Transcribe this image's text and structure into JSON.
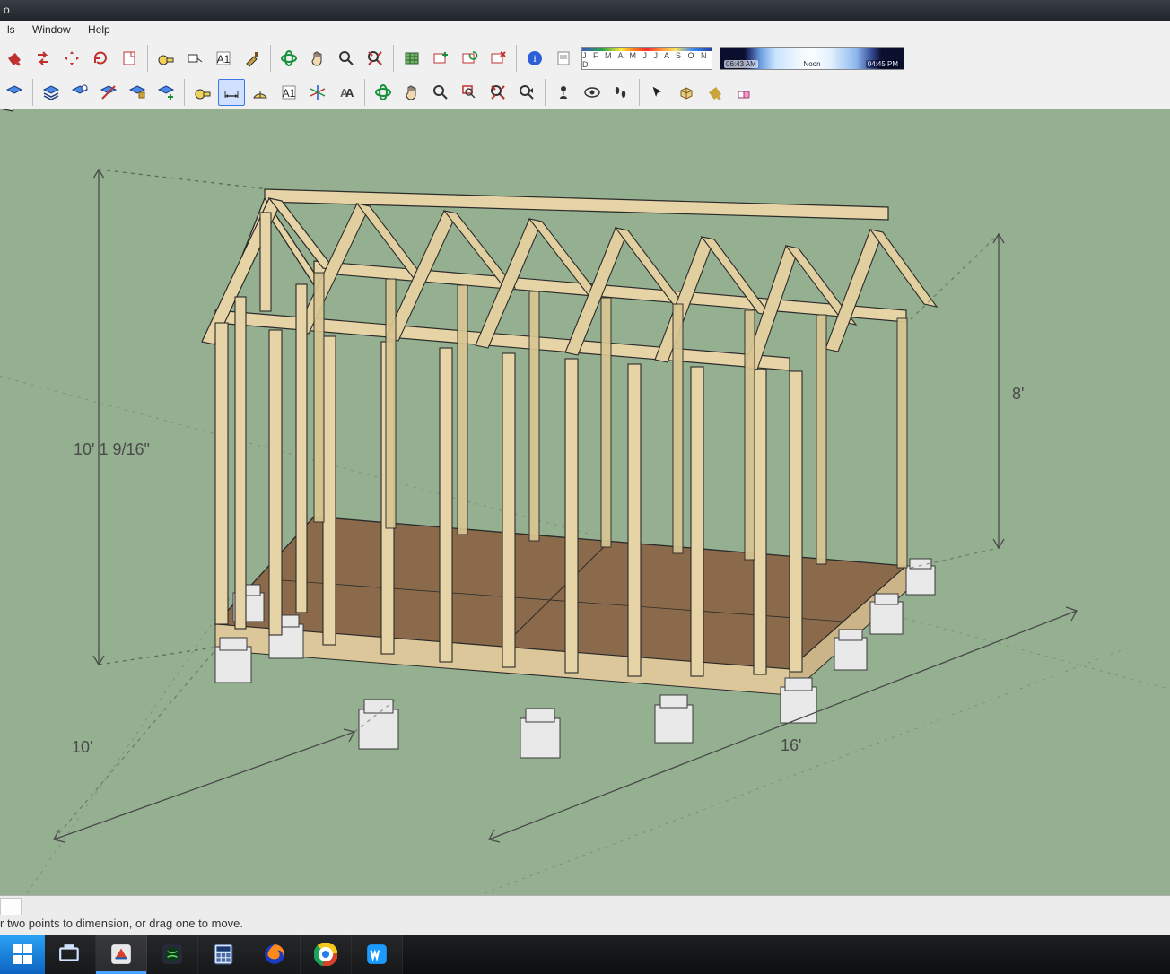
{
  "titlebar": {
    "fragment": "o"
  },
  "menu": {
    "items": [
      "ls",
      "Window",
      "Help"
    ]
  },
  "toolbar": {
    "row1": [
      {
        "n": "paint-bucket-icon",
        "i": "bucket",
        "c": "#c03030"
      },
      {
        "n": "hide-icon",
        "i": "arrowswap",
        "c": "#c03030"
      },
      {
        "n": "move-icon",
        "i": "movecross",
        "c": "#c03030"
      },
      {
        "n": "refresh-icon",
        "i": "refresh",
        "c": "#c03030"
      },
      {
        "n": "page-icon",
        "i": "pagecorner",
        "c": "#c03030"
      },
      {
        "n": "SEP"
      },
      {
        "n": "tape-icon",
        "i": "tape",
        "c": "#333"
      },
      {
        "n": "label-icon",
        "i": "labeltag",
        "c": "#333"
      },
      {
        "n": "text-icon",
        "i": "textA",
        "c": "#333"
      },
      {
        "n": "axis-brush-icon",
        "i": "brush",
        "c": "#c89018"
      },
      {
        "n": "SEP"
      },
      {
        "n": "orbit-icon",
        "i": "orbit",
        "c": "#17913a"
      },
      {
        "n": "pan-icon",
        "i": "hand",
        "c": "#333"
      },
      {
        "n": "zoom-icon",
        "i": "magnify",
        "c": "#333"
      },
      {
        "n": "zoom-extent-icon",
        "i": "zoomcross",
        "c": "#c03030"
      },
      {
        "n": "SEP"
      },
      {
        "n": "map-icon",
        "i": "map",
        "c": "#40903a"
      },
      {
        "n": "scene-add-icon",
        "i": "sceneplus",
        "c": "#c03030"
      },
      {
        "n": "scene-update-icon",
        "i": "scenerefresh",
        "c": "#c03030"
      },
      {
        "n": "scene-delete-icon",
        "i": "scenex",
        "c": "#c03030"
      },
      {
        "n": "SEP"
      },
      {
        "n": "info-icon",
        "i": "infoball",
        "c": "#2050b0"
      },
      {
        "n": "note-icon",
        "i": "notepage",
        "c": "#777"
      },
      {
        "n": "WIDGET-months"
      },
      {
        "n": "WIDGET-daytime"
      }
    ],
    "row2": [
      {
        "n": "layer-icon",
        "i": "layer",
        "c": "#2a6bd4"
      },
      {
        "n": "SEP"
      },
      {
        "n": "layers-all-icon",
        "i": "layers",
        "c": "#2a6bd4"
      },
      {
        "n": "layer-single-icon",
        "i": "layer1",
        "c": "#2a6bd4"
      },
      {
        "n": "layer-hidden-icon",
        "i": "layerh",
        "c": "#2a6bd4"
      },
      {
        "n": "layer-fill-icon",
        "i": "layerf",
        "c": "#2a6bd4"
      },
      {
        "n": "layer-add-icon",
        "i": "layerplus",
        "c": "#2a6bd4"
      },
      {
        "n": "SEP"
      },
      {
        "n": "tape2-icon",
        "i": "tape",
        "c": "#c89018"
      },
      {
        "n": "dimension-icon",
        "i": "dimension",
        "active": true,
        "c": "#333"
      },
      {
        "n": "protractor-icon",
        "i": "protractor",
        "c": "#c89018"
      },
      {
        "n": "text2-icon",
        "i": "textA",
        "c": "#333"
      },
      {
        "n": "axis-icon",
        "i": "axiscross",
        "c": "#333"
      },
      {
        "n": "3dtext-icon",
        "i": "text3d",
        "c": "#555"
      },
      {
        "n": "SEP"
      },
      {
        "n": "orbit2-icon",
        "i": "orbit",
        "c": "#17913a"
      },
      {
        "n": "pan2-icon",
        "i": "hand",
        "c": "#333"
      },
      {
        "n": "zoom2-icon",
        "i": "magnify",
        "c": "#333"
      },
      {
        "n": "zoom-window-icon",
        "i": "zoomwin",
        "c": "#c03030"
      },
      {
        "n": "zoom-extents2-icon",
        "i": "zoomcross",
        "c": "#c03030"
      },
      {
        "n": "zoom-prev-icon",
        "i": "zoomback",
        "c": "#333"
      },
      {
        "n": "SEP"
      },
      {
        "n": "position-camera-icon",
        "i": "personpin",
        "c": "#333"
      },
      {
        "n": "look-around-icon",
        "i": "eye",
        "c": "#333"
      },
      {
        "n": "walk-icon",
        "i": "footprints",
        "c": "#333"
      },
      {
        "n": "SEP"
      },
      {
        "n": "select-icon",
        "i": "cursor",
        "c": "#222"
      },
      {
        "n": "component-icon",
        "i": "component",
        "c": "#caa43a"
      },
      {
        "n": "paint2-icon",
        "i": "bucket",
        "c": "#caa43a"
      },
      {
        "n": "eraser-icon",
        "i": "eraser",
        "c": "#e85aa0"
      }
    ]
  },
  "shadow": {
    "months": "J F M A M J J A S O N D",
    "sunrise": "06:43 AM",
    "noon": "Noon",
    "sunset": "04:45 PM"
  },
  "viewport": {
    "dimensions": {
      "height_left": "10' 1 9/16\"",
      "width_front": "10'",
      "length_right": "16'",
      "wall_height_right": "8'"
    }
  },
  "statusbar": {
    "hint": "r two points to dimension, or drag one to move."
  },
  "taskbar": {
    "items": [
      {
        "n": "start-menu",
        "i": "winlogo"
      },
      {
        "n": "taskview",
        "i": "taskview"
      },
      {
        "n": "sketchup-app",
        "i": "su",
        "active": true
      },
      {
        "n": "xbox-app",
        "i": "xbox"
      },
      {
        "n": "calculator-app",
        "i": "calc"
      },
      {
        "n": "firefox-app",
        "i": "firefox"
      },
      {
        "n": "chrome-app",
        "i": "chrome"
      },
      {
        "n": "wps-app",
        "i": "wps"
      }
    ]
  }
}
